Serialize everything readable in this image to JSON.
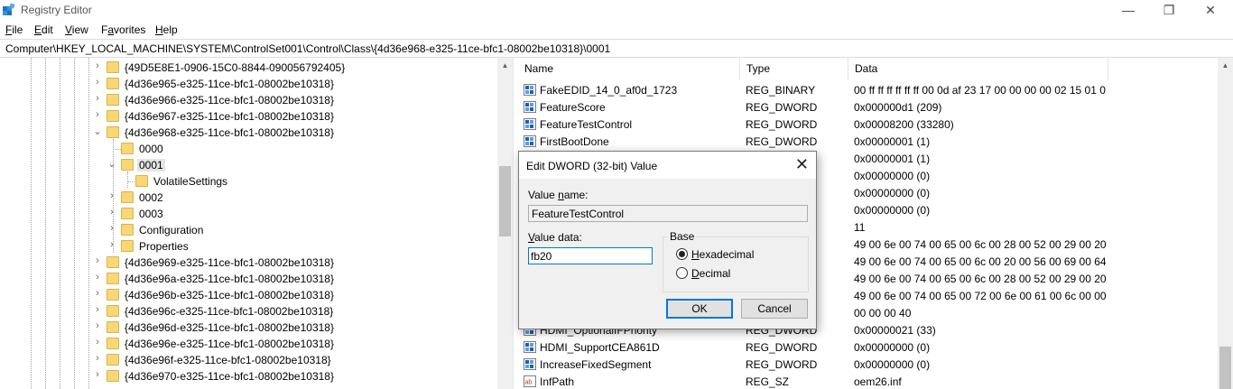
{
  "window": {
    "title": "Registry Editor",
    "minimize_glyph": "—",
    "maximize_glyph": "❐",
    "close_glyph": "✕"
  },
  "menu": {
    "file": {
      "key": "F",
      "rest": "ile"
    },
    "edit": {
      "key": "E",
      "rest": "dit"
    },
    "view": {
      "key": "V",
      "rest": "iew"
    },
    "favorites": {
      "pre": "F",
      "key": "a",
      "rest": "vorites"
    },
    "help": {
      "key": "H",
      "rest": "elp"
    }
  },
  "address": "Computer\\HKEY_LOCAL_MACHINE\\SYSTEM\\ControlSet001\\Control\\Class\\{4d36e968-e325-11ce-bfc1-08002be10318}\\0001",
  "tree": {
    "items": [
      {
        "label": "{49D5E8E1-0906-15C0-8844-090056792405}",
        "expander": "›"
      },
      {
        "label": "{4d36e965-e325-11ce-bfc1-08002be10318}",
        "expander": "›"
      },
      {
        "label": "{4d36e966-e325-11ce-bfc1-08002be10318}",
        "expander": "›"
      },
      {
        "label": "{4d36e967-e325-11ce-bfc1-08002be10318}",
        "expander": "›"
      },
      {
        "label": "{4d36e968-e325-11ce-bfc1-08002be10318}",
        "expander": "⌄"
      },
      {
        "label": "0000",
        "expander": ""
      },
      {
        "label": "0001",
        "expander": "⌄"
      },
      {
        "label": "VolatileSettings",
        "expander": ""
      },
      {
        "label": "0002",
        "expander": "›"
      },
      {
        "label": "0003",
        "expander": "›"
      },
      {
        "label": "Configuration",
        "expander": "›"
      },
      {
        "label": "Properties",
        "expander": "›"
      },
      {
        "label": "{4d36e969-e325-11ce-bfc1-08002be10318}",
        "expander": "›"
      },
      {
        "label": "{4d36e96a-e325-11ce-bfc1-08002be10318}",
        "expander": "›"
      },
      {
        "label": "{4d36e96b-e325-11ce-bfc1-08002be10318}",
        "expander": "›"
      },
      {
        "label": "{4d36e96c-e325-11ce-bfc1-08002be10318}",
        "expander": "›"
      },
      {
        "label": "{4d36e96d-e325-11ce-bfc1-08002be10318}",
        "expander": "›"
      },
      {
        "label": "{4d36e96e-e325-11ce-bfc1-08002be10318}",
        "expander": "›"
      },
      {
        "label": "{4d36e96f-e325-11ce-bfc1-08002be10318}",
        "expander": "›"
      },
      {
        "label": "{4d36e970-e325-11ce-bfc1-08002be10318}",
        "expander": "›"
      }
    ]
  },
  "list": {
    "columns": {
      "name": "Name",
      "type": "Type",
      "data": "Data"
    },
    "rows": [
      {
        "name": "FakeEDID_14_0_af0d_1723",
        "type": "REG_BINARY",
        "data": "00 ff ff ff ff ff ff 00 0d af 23 17 00 00 00 00 02 15 01 0...",
        "icon": "binary-value-icon"
      },
      {
        "name": "FeatureScore",
        "type": "REG_DWORD",
        "data": "0x000000d1 (209)",
        "icon": "binary-value-icon"
      },
      {
        "name": "FeatureTestControl",
        "type": "REG_DWORD",
        "data": "0x00008200 (33280)",
        "icon": "binary-value-icon"
      },
      {
        "name": "FirstBootDone",
        "type": "REG_DWORD",
        "data": "0x00000001 (1)",
        "icon": "binary-value-icon"
      },
      {
        "name": "",
        "type": "",
        "data": "0x00000001 (1)",
        "icon": ""
      },
      {
        "name": "",
        "type": "",
        "data": "0x00000000 (0)",
        "icon": ""
      },
      {
        "name": "",
        "type": "",
        "data": "0x00000000 (0)",
        "icon": ""
      },
      {
        "name": "",
        "type": "",
        "data": "0x00000000 (0)",
        "icon": ""
      },
      {
        "name": "",
        "type": "",
        "data": "11",
        "icon": ""
      },
      {
        "name": "",
        "type": "",
        "data": "49 00 6e 00 74 00 65 00 6c 00 28 00 52 00 29 00 20 00...",
        "icon": ""
      },
      {
        "name": "",
        "type": "",
        "data": "49 00 6e 00 74 00 65 00 6c 00 20 00 56 00 69 00 64 00...",
        "icon": ""
      },
      {
        "name": "",
        "type": "",
        "data": "49 00 6e 00 74 00 65 00 6c 00 28 00 52 00 29 00 20 00...",
        "icon": ""
      },
      {
        "name": "",
        "type": "",
        "data": "49 00 6e 00 74 00 65 00 72 00 6e 00 61 00 6c 00 00 00",
        "icon": ""
      },
      {
        "name": "",
        "type": "",
        "data": "00 00 00 40",
        "icon": ""
      },
      {
        "name": "HDMI_OptionalIFPriority",
        "type": "REG_DWORD",
        "data": "0x00000021 (33)",
        "icon": "binary-value-icon"
      },
      {
        "name": "HDMI_SupportCEA861D",
        "type": "REG_DWORD",
        "data": "0x00000000 (0)",
        "icon": "binary-value-icon"
      },
      {
        "name": "IncreaseFixedSegment",
        "type": "REG_DWORD",
        "data": "0x00000000 (0)",
        "icon": "binary-value-icon"
      },
      {
        "name": "InfPath",
        "type": "REG_SZ",
        "data": "oem26.inf",
        "icon": "string-value-icon"
      }
    ]
  },
  "dialog": {
    "title": "Edit DWORD (32-bit) Value",
    "value_name_label": {
      "key": "",
      "pre": "Value ",
      "underline": "n",
      "rest": "ame:"
    },
    "value_name": "FeatureTestControl",
    "value_data_label": {
      "pre": "",
      "underline": "V",
      "rest": "alue data:"
    },
    "value_data": "fb20",
    "base_label": "Base",
    "hex_label": {
      "underline": "H",
      "rest": "exadecimal"
    },
    "dec_label": {
      "underline": "D",
      "rest": "ecimal"
    },
    "base_selected": "hexadecimal",
    "ok": "OK",
    "cancel": "Cancel"
  }
}
